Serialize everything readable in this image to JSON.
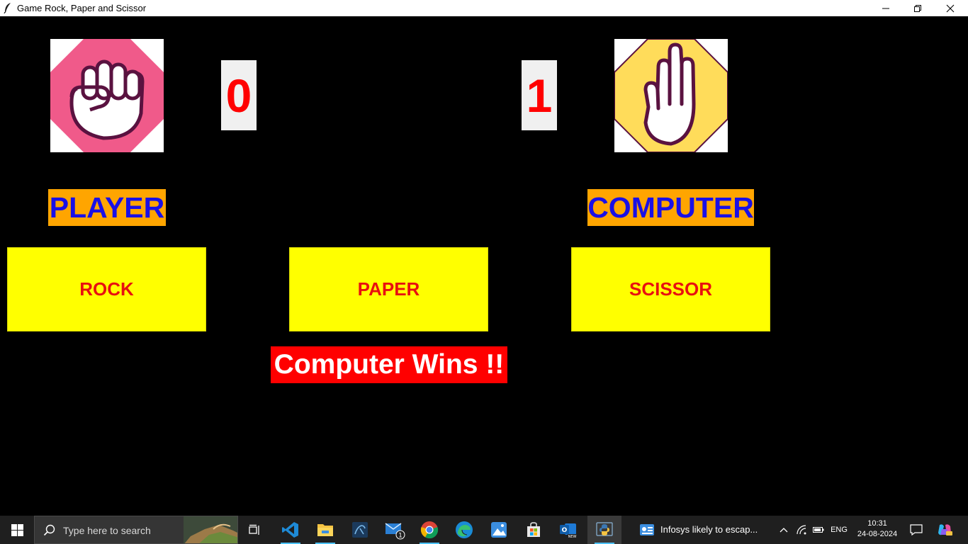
{
  "window": {
    "title": "Game Rock, Paper and Scissor"
  },
  "game": {
    "player_score": "0",
    "computer_score": "1",
    "player_label": "PLAYER",
    "computer_label": "COMPUTER",
    "player_hand_icon": "rock-fist-icon",
    "computer_hand_icon": "paper-hand-icon",
    "buttons": {
      "rock": "ROCK",
      "paper": "PAPER",
      "scissor": "SCISSOR"
    },
    "result": "Computer Wins !!",
    "colors": {
      "background": "#000000",
      "player_hand_bg": "#f05a8a",
      "computer_hand_bg": "#ffdc5a",
      "label_bg": "#ffa500",
      "label_text": "#1a10e6",
      "button_bg": "#ffff00",
      "button_text": "#e81010",
      "result_bg": "#ff0000",
      "score_text": "#ff0000"
    }
  },
  "taskbar": {
    "search_placeholder": "Type here to search",
    "apps": [
      "task-view",
      "vs-code",
      "file-explorer",
      "mysql-workbench",
      "mail",
      "chrome",
      "edge",
      "photos",
      "store",
      "outlook",
      "python"
    ],
    "mail_badge": "1",
    "news_text": "Infosys likely to escap...",
    "language": "ENG",
    "time": "10:31",
    "date": "24-08-2024"
  }
}
